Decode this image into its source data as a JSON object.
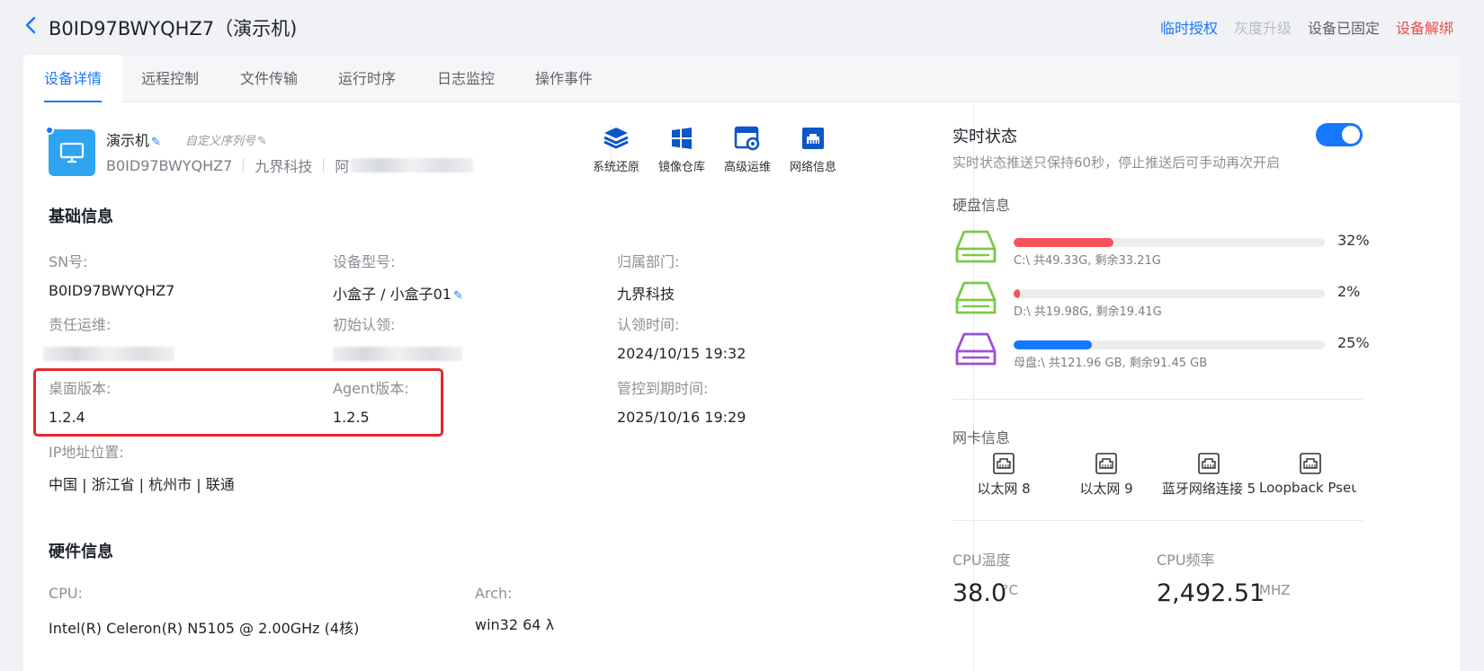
{
  "header": {
    "title": "B0ID97BWYQHZ7（演示机)",
    "actions": {
      "temp_auth": "临时授权",
      "gray_upgrade": "灰度升级",
      "fixed": "设备已固定",
      "unbind": "设备解绑"
    }
  },
  "tabs": [
    "设备详情",
    "远程控制",
    "文件传输",
    "运行时序",
    "日志监控",
    "操作事件"
  ],
  "device": {
    "name": "演示机",
    "custom_sn_placeholder": "自定义序列号",
    "sn": "B0ID97BWYQHZ7",
    "company": "九界科技",
    "extra_prefix": "阿"
  },
  "tools": [
    "系统还原",
    "镜像仓库",
    "高级运维",
    "网络信息"
  ],
  "basic": {
    "title": "基础信息",
    "sn_label": "SN号:",
    "sn_value": "B0ID97BWYQHZ7",
    "model_label": "设备型号:",
    "model_value": "小盒子  / 小盒子01",
    "dept_label": "归属部门:",
    "dept_value": "九界科技",
    "ops_label": "责任运维:",
    "claim_label": "初始认领:",
    "claim_time_label": "认领时间:",
    "claim_time_value": "2024/10/15 19:32",
    "desktop_label": "桌面版本:",
    "desktop_value": "1.2.4",
    "agent_label": "Agent版本:",
    "agent_value": "1.2.5",
    "expire_label": "管控到期时间:",
    "expire_value": "2025/10/16 19:29",
    "ip_label": "IP地址位置:",
    "ip_value": "中国 | 浙江省 | 杭州市 | 联通"
  },
  "hardware": {
    "title": "硬件信息",
    "cpu_label": "CPU:",
    "cpu_value": "Intel(R) Celeron(R) N5105 @ 2.00GHz (4核)",
    "arch_label": "Arch:",
    "arch_value": "win32 64 λ"
  },
  "realtime": {
    "title": "实时状态",
    "desc": "实时状态推送只保持60秒，停止推送后可手动再次开启",
    "toggle_on": true,
    "disk_title": "硬盘信息",
    "disks": [
      {
        "info": "C:\\ 共49.33G, 剩余33.21G",
        "percent": 32,
        "pct_text": "32%",
        "color": "#f5545c",
        "icon_color": "#7cc94a"
      },
      {
        "info": "D:\\ 共19.98G, 剩余19.41G",
        "percent": 2,
        "pct_text": "2%",
        "color": "#f5545c",
        "icon_color": "#7cc94a"
      },
      {
        "info": "母盘:\\ 共121.96 GB, 剩余91.45 GB",
        "percent": 25,
        "pct_text": "25%",
        "color": "#1677ff",
        "icon_color": "#9b4fd6"
      }
    ],
    "nic_title": "网卡信息",
    "nics": [
      "以太网 8",
      "以太网 9",
      "蓝牙网络连接 5",
      "Loopback Pseudo"
    ],
    "cpu_temp_label": "CPU温度",
    "cpu_temp_value": "38.0",
    "cpu_temp_unit": "°C",
    "cpu_freq_label": "CPU频率",
    "cpu_freq_value": "2,492.51",
    "cpu_freq_unit": "MHZ"
  },
  "colors": {
    "accent": "#1677ff",
    "danger": "#f04848",
    "highlight": "#e8262a"
  }
}
